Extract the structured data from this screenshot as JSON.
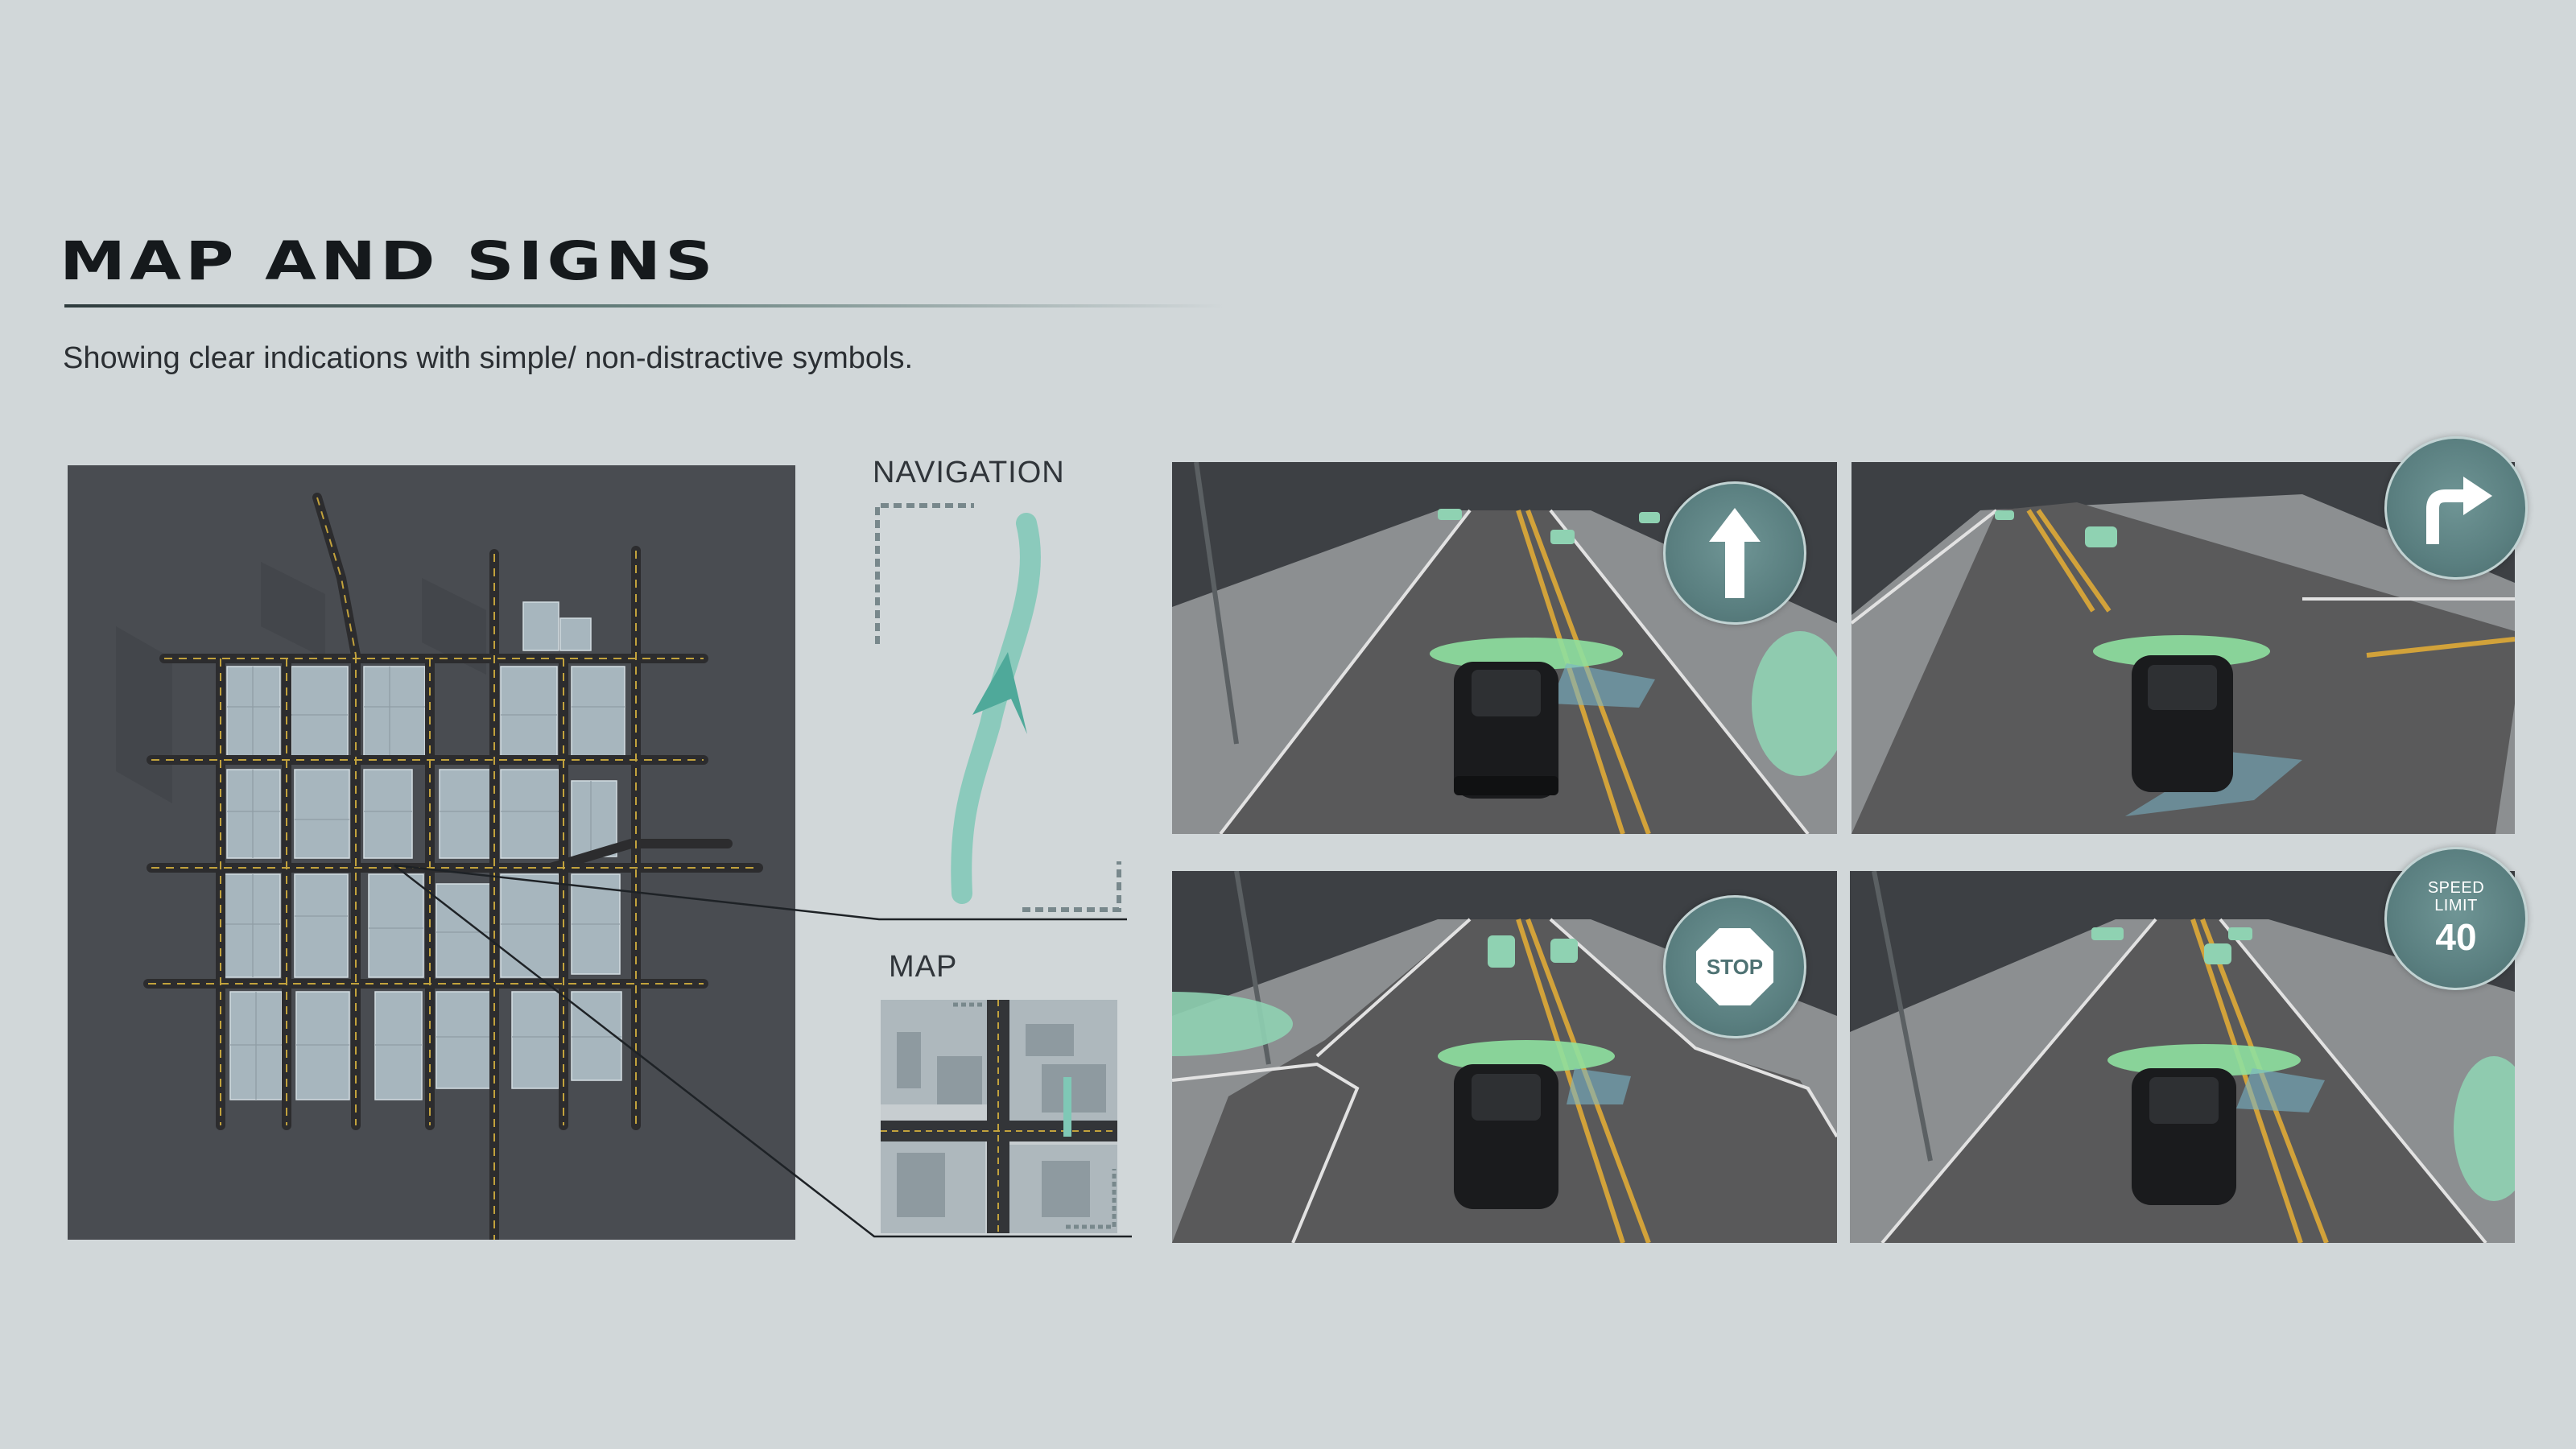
{
  "header": {
    "title": "MAP AND SIGNS",
    "subtitle": "Showing clear indications with simple/ non-distractive symbols."
  },
  "labels": {
    "navigation": "NAVIGATION",
    "map": "MAP"
  },
  "signs": {
    "straight": "straight-arrow-icon",
    "right_turn": "right-turn-arrow-icon",
    "stop": "STOP",
    "speed_limit_label": "SPEED LIMIT",
    "speed_limit_value": "40"
  },
  "colors": {
    "background": "#d1d7d9",
    "accent_teal": "#7fc8b6",
    "sign_fill": "#5a7f80",
    "highlight_green": "#8ee0a0",
    "map_bg": "#494c51"
  }
}
